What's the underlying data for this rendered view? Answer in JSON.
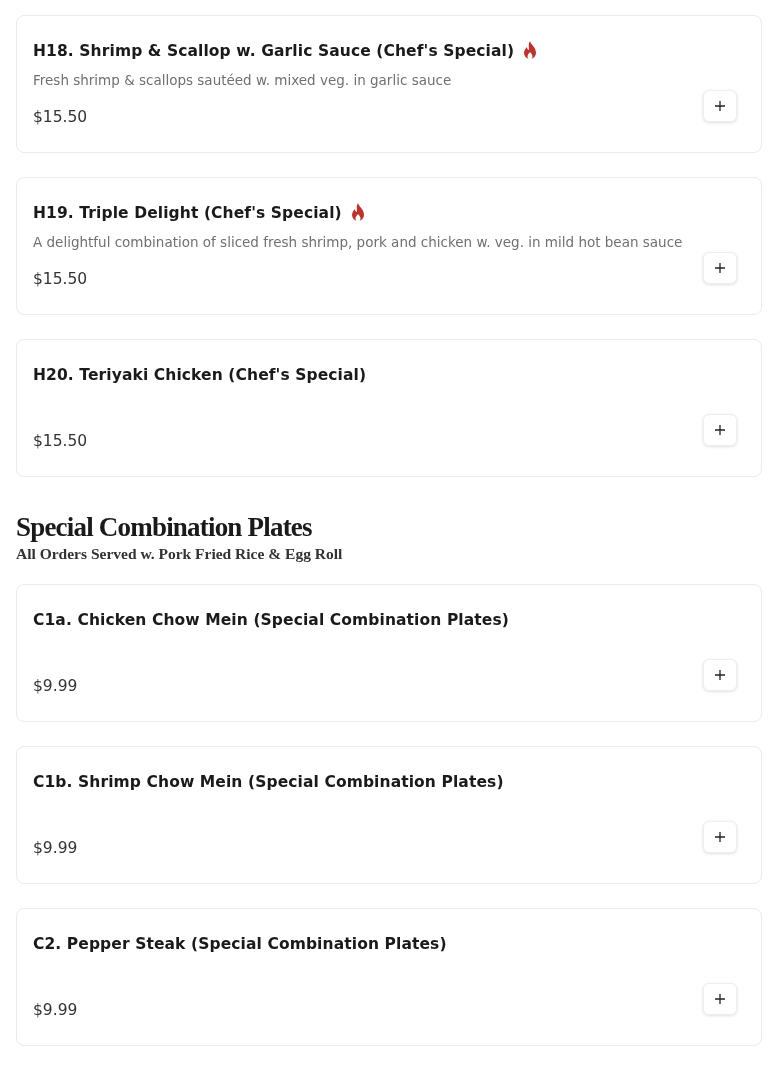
{
  "sections": [
    {
      "items": [
        {
          "name": "H18. Shrimp & Scallop w. Garlic Sauce (Chef's Special)",
          "spicy": true,
          "description": "Fresh shrimp & scallops sautéed w. mixed veg. in garlic sauce",
          "price": "$15.50"
        },
        {
          "name": "H19. Triple Delight (Chef's Special)",
          "spicy": true,
          "description": "A delightful combination of sliced fresh shrimp, pork and chicken w. veg. in mild hot bean sauce",
          "price": "$15.50"
        },
        {
          "name": "H20. Teriyaki Chicken (Chef's Special)",
          "spicy": false,
          "price": "$15.50"
        }
      ]
    },
    {
      "title": "Special Combination Plates",
      "subtitle": "All Orders Served w. Pork Fried Rice & Egg Roll",
      "items": [
        {
          "name": "C1a. Chicken Chow Mein (Special Combination Plates)",
          "spicy": false,
          "price": "$9.99"
        },
        {
          "name": "C1b. Shrimp Chow Mein (Special Combination Plates)",
          "spicy": false,
          "price": "$9.99"
        },
        {
          "name": "C2. Pepper Steak (Special Combination Plates)",
          "spicy": false,
          "price": "$9.99"
        }
      ]
    }
  ]
}
